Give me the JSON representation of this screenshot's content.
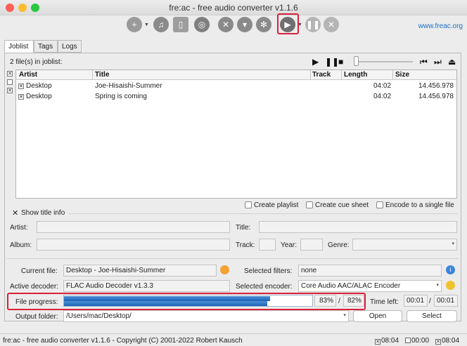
{
  "window": {
    "title": "fre:ac - free audio converter v1.1.6"
  },
  "toolbar": {
    "website_link": "www.freac.org"
  },
  "tabs": [
    {
      "label": "Joblist"
    },
    {
      "label": "Tags"
    },
    {
      "label": "Logs"
    }
  ],
  "joblist": {
    "count_text": "2 file(s) in joblist:",
    "columns": {
      "artist": "Artist",
      "title": "Title",
      "track": "Track",
      "length": "Length",
      "size": "Size"
    },
    "rows": [
      {
        "checked": true,
        "artist": "Desktop",
        "title": "Joe-Hisaishi-Summer",
        "track": "",
        "length": "04:02",
        "size": "14.456.978"
      },
      {
        "checked": true,
        "artist": "Desktop",
        "title": "Spring is coming",
        "track": "",
        "length": "04:02",
        "size": "14.456.978"
      }
    ]
  },
  "options": {
    "create_playlist": "Create playlist",
    "create_cue_sheet": "Create cue sheet",
    "encode_single": "Encode to a single file",
    "show_title_info": "Show title info"
  },
  "title_info": {
    "artist_label": "Artist:",
    "title_label": "Title:",
    "album_label": "Album:",
    "track_label": "Track:",
    "year_label": "Year:",
    "genre_label": "Genre:"
  },
  "status": {
    "current_file_label": "Current file:",
    "current_file": "Desktop - Joe-Hisaishi-Summer",
    "selected_filters_label": "Selected filters:",
    "selected_filters": "none",
    "active_decoder_label": "Active decoder:",
    "active_decoder": "FLAC Audio Decoder v1.3.3",
    "selected_encoder_label": "Selected encoder:",
    "selected_encoder": "Core Audio AAC/ALAC Encoder",
    "file_progress_label": "File progress:",
    "file_progress_percent": "83%",
    "separator": "/",
    "total_progress_percent": "82%",
    "file_progress_fraction": 0.83,
    "total_progress_fraction": 0.82,
    "time_left_label": "Time left:",
    "time_left": "00:01",
    "time_total": "00:01",
    "output_folder_label": "Output folder:",
    "output_folder": "/Users/mac/Desktop/",
    "open_button": "Open",
    "select_button": "Select"
  },
  "statusbar": {
    "text": "fre:ac - free audio converter v1.1.6 - Copyright (C) 2001-2022 Robert Kausch",
    "sel_time": "08:04",
    "unsel_time": "00:00",
    "total_time": "08:04"
  },
  "colors": {
    "highlight": "#d9213a",
    "progress": "#1e63b8",
    "link": "#1a6fc4"
  }
}
